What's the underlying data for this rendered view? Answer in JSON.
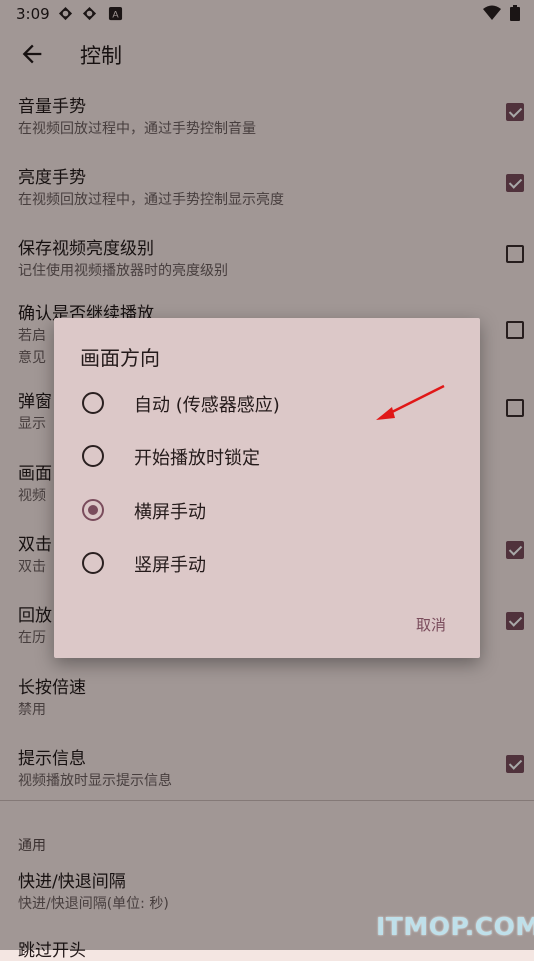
{
  "status_bar": {
    "time": "3:09",
    "icons": [
      "sync-icon",
      "sync-icon",
      "a-icon"
    ],
    "right_icons": [
      "wifi-icon",
      "battery-icon"
    ]
  },
  "app_bar": {
    "title": "控制"
  },
  "settings": [
    {
      "title": "音量手势",
      "subtitle": "在视频回放过程中，通过手势控制音量",
      "checked": true
    },
    {
      "title": "亮度手势",
      "subtitle": "在视频回放过程中，通过手势控制显示亮度",
      "checked": true
    },
    {
      "title": "保存视频亮度级别",
      "subtitle": "记住使用视频播放器时的亮度级别",
      "checked": false
    },
    {
      "title": "确认是否继续播放",
      "subtitle": "若启",
      "subtitle2": "意见",
      "checked": false
    },
    {
      "title": "弹窗",
      "subtitle": "显示",
      "checked": false
    },
    {
      "title": "画面",
      "subtitle": "视频"
    },
    {
      "title": "双击",
      "subtitle": "双击",
      "checked": true
    },
    {
      "title": "回放",
      "subtitle": "在历",
      "checked": true
    },
    {
      "title": "长按倍速",
      "subtitle": "禁用"
    },
    {
      "title": "提示信息",
      "subtitle": "视频播放时显示提示信息",
      "checked": true
    }
  ],
  "section": {
    "header": "通用",
    "items": [
      {
        "title": "快进/快退间隔",
        "subtitle": "快进/快退间隔(单位: 秒)"
      },
      {
        "title": "跳过开头"
      }
    ]
  },
  "dialog": {
    "title": "画面方向",
    "options": [
      {
        "label": "自动 (传感器感应)",
        "selected": false
      },
      {
        "label": "开始播放时锁定",
        "selected": false
      },
      {
        "label": "横屏手动",
        "selected": true
      },
      {
        "label": "竖屏手动",
        "selected": false
      }
    ],
    "cancel_label": "取消"
  },
  "watermark": "ITMOP.COM",
  "colors": {
    "accent": "#7a4c5c",
    "dialog_bg": "#dcc8c8",
    "arrow": "#e01818"
  }
}
